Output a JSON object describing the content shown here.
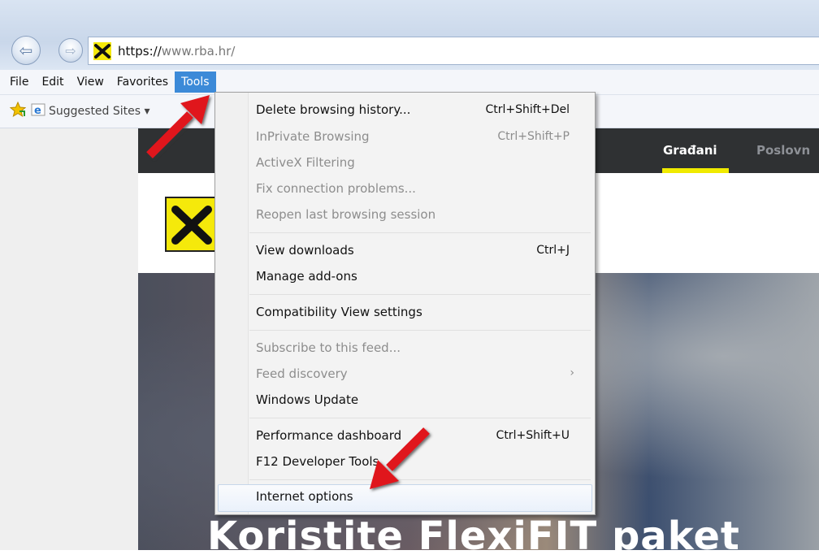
{
  "browser": {
    "url_host_prefix": "https://",
    "url_domain": "www.rba.hr/",
    "menubar": [
      "File",
      "Edit",
      "View",
      "Favorites",
      "Tools"
    ],
    "favorites": {
      "suggested_sites": "Suggested Sites ▾"
    }
  },
  "website": {
    "nav": {
      "gradani": "Građani",
      "poslovni": "Poslovn"
    },
    "hero_title": "Koristite FlexiFIT paket"
  },
  "tools_menu": {
    "items": [
      {
        "label": "Delete browsing history...",
        "shortcut": "Ctrl+Shift+Del"
      },
      {
        "label": "InPrivate Browsing",
        "shortcut": "Ctrl+Shift+P"
      },
      {
        "label": "ActiveX Filtering",
        "shortcut": ""
      },
      {
        "label": "Fix connection problems...",
        "shortcut": ""
      },
      {
        "label": "Reopen last browsing session",
        "shortcut": ""
      },
      {
        "label": "View downloads",
        "shortcut": "Ctrl+J"
      },
      {
        "label": "Manage add-ons",
        "shortcut": ""
      },
      {
        "label": "Compatibility View settings",
        "shortcut": ""
      },
      {
        "label": "Subscribe to this feed...",
        "shortcut": ""
      },
      {
        "label": "Feed discovery",
        "shortcut": "›"
      },
      {
        "label": "Windows Update",
        "shortcut": ""
      },
      {
        "label": "Performance dashboard",
        "shortcut": "Ctrl+Shift+U"
      },
      {
        "label": "F12 Developer Tools",
        "shortcut": ""
      },
      {
        "label": "Internet options",
        "shortcut": ""
      }
    ]
  },
  "colors": {
    "menu_highlight": "#3c8ad8",
    "arrow_red": "#e0141e",
    "site_accent": "#f0ea00"
  }
}
